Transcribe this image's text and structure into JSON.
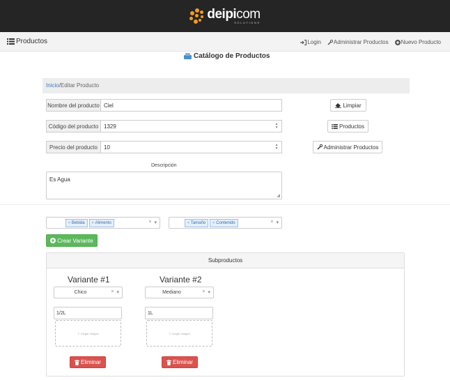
{
  "colors": {
    "topbar": "#252525",
    "logo_orange": "#f39a1f",
    "link": "#3a7bbf",
    "green": "#5cb85c",
    "red": "#d9534f",
    "tag_bg": "#e4effa"
  },
  "logo": {
    "word_bold": "deipi",
    "word_light": "com",
    "sub": "SOLUTIONS"
  },
  "nav": {
    "brand_icon": "list-icon",
    "brand": "Productos",
    "links": [
      {
        "icon": "login-icon",
        "label": "Login"
      },
      {
        "icon": "wrench-icon",
        "label": "Administrar Productos"
      },
      {
        "icon": "plus-circle-icon",
        "label": "Nuevo Producto"
      }
    ]
  },
  "page": {
    "title_icon": "catalog-icon",
    "title": "Catálogo de Productos"
  },
  "breadcrumb": {
    "home": "Inicio",
    "separator": "/",
    "current": "Editar Producto"
  },
  "form": {
    "name": {
      "label": "Nombre del producto",
      "value": "Ciel"
    },
    "code": {
      "label": "Código del producto",
      "value": "1329"
    },
    "price": {
      "label": "Precio del producto",
      "value": "10"
    },
    "description": {
      "label": "Descripción",
      "value": "Es Agua"
    }
  },
  "side_buttons": {
    "clear": {
      "icon": "eraser-icon",
      "label": "Limpiar"
    },
    "products": {
      "icon": "list-icon",
      "label": "Productos"
    },
    "admin": {
      "icon": "wrench-icon",
      "label": "Administrar Productos"
    }
  },
  "attribute_selects": [
    {
      "tags": [
        "Bebida",
        "Alimento"
      ]
    },
    {
      "tags": [
        "Tamaño",
        "Contenido"
      ]
    }
  ],
  "create_variant": {
    "icon": "plus-circle-icon",
    "label": "Crear Variante"
  },
  "subproducts": {
    "title": "Subproductos",
    "variants": [
      {
        "title": "Variante #1",
        "option": "Chico",
        "value": "1/2L",
        "upload_label": "Cargar imagen",
        "delete_label": "Eliminar"
      },
      {
        "title": "Variante #2",
        "option": "Mediano",
        "value": "1L",
        "upload_label": "Cargar imagen",
        "delete_label": "Eliminar"
      }
    ]
  }
}
